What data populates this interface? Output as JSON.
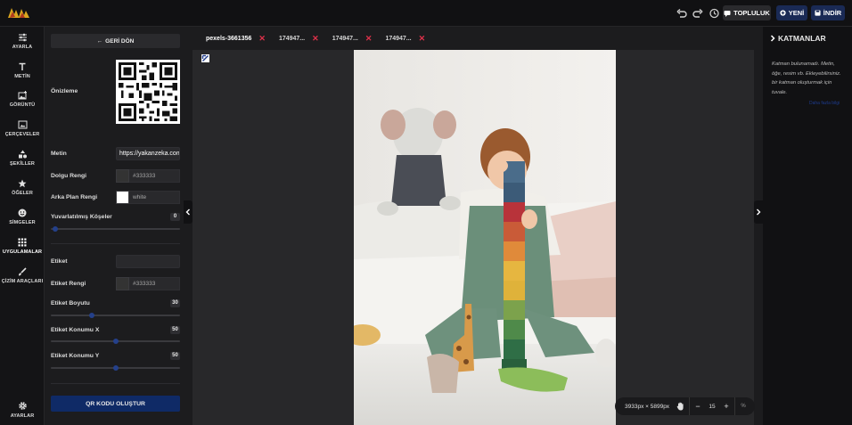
{
  "app": {
    "logo_text": "aKKA"
  },
  "topbar": {
    "undo_icon": "undo-icon",
    "redo_icon": "redo-icon",
    "history_icon": "history-icon",
    "toplu_label": "TOPLULUK",
    "yeni_label": "YENİ",
    "indir_label": "İNDİR"
  },
  "sidebar": {
    "items": [
      {
        "label": "AYARLA",
        "icon": "sliders-icon"
      },
      {
        "label": "METİN",
        "icon": "text-icon"
      },
      {
        "label": "GÖRÜNTÜ",
        "icon": "image-icon"
      },
      {
        "label": "ÇERÇEVELER",
        "icon": "frame-icon"
      },
      {
        "label": "ŞEKİLLER",
        "icon": "shapes-icon"
      },
      {
        "label": "ÖĞELER",
        "icon": "star-icon"
      },
      {
        "label": "SİMGELER",
        "icon": "emoji-icon"
      },
      {
        "label": "UYGULAMALAR",
        "icon": "apps-grid-icon"
      },
      {
        "label": "ÇİZİM ARAÇLARI",
        "icon": "brush-icon"
      }
    ],
    "settings_label": "AYARLAR"
  },
  "panel": {
    "back_label": "GERİ DÖN",
    "preview_label": "Önizleme",
    "text_label": "Metin",
    "text_value": "https://yakanzeka.com",
    "fill_label": "Dolgu Rengi",
    "fill_value": "#333333",
    "fill_color": "#333333",
    "bg_label": "Arka Plan Rengi",
    "bg_value": "white",
    "bg_color": "#ffffff",
    "radius_label": "Yuvarlatılmış Köşeler",
    "radius_value": "0",
    "tag_label": "Etiket",
    "tag_value": "",
    "tag_color_label": "Etiket Rengi",
    "tag_color_value": "#333333",
    "tag_size_label": "Etiket Boyutu",
    "tag_size_value": "30",
    "tag_x_label": "Etiket Konumu X",
    "tag_x_value": "50",
    "tag_y_label": "Etiket Konumu Y",
    "tag_y_value": "50",
    "create_label": "QR KODU OLUŞTUR"
  },
  "tabs": [
    {
      "label": "pexels-3661356",
      "active": true
    },
    {
      "label": "174947...",
      "active": false
    },
    {
      "label": "174947...",
      "active": false
    },
    {
      "label": "174947...",
      "active": false
    }
  ],
  "status": {
    "dimensions": "3933px × 5899px",
    "zoom": "15",
    "minus": "−",
    "plus": "+",
    "pct": "%"
  },
  "layers": {
    "title": "KATMANLAR",
    "hint": "Katman bulunamadı. Metin, öğe, resim vb. Ekleyebilirsiniz. bir katman oluşturmak için tuvale.",
    "link": "Daha fazla bilgi"
  }
}
